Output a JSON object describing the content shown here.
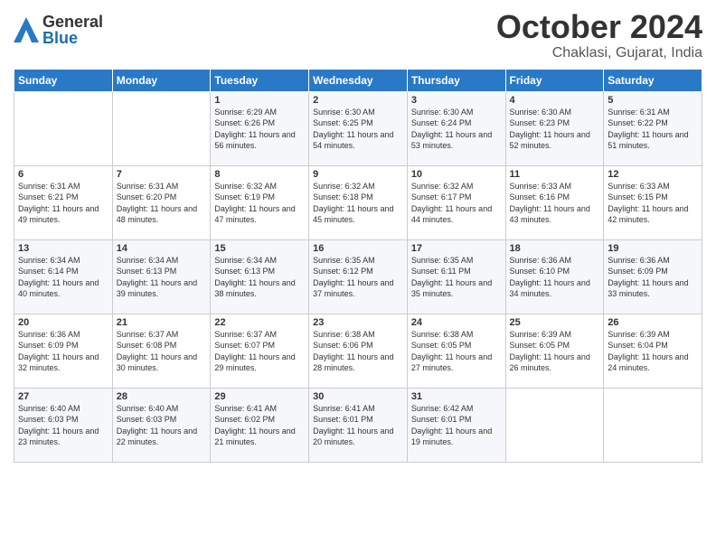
{
  "header": {
    "logo_general": "General",
    "logo_blue": "Blue",
    "month_title": "October 2024",
    "location": "Chaklasi, Gujarat, India"
  },
  "days_of_week": [
    "Sunday",
    "Monday",
    "Tuesday",
    "Wednesday",
    "Thursday",
    "Friday",
    "Saturday"
  ],
  "weeks": [
    [
      {
        "day": "",
        "sunrise": "",
        "sunset": "",
        "daylight": ""
      },
      {
        "day": "",
        "sunrise": "",
        "sunset": "",
        "daylight": ""
      },
      {
        "day": "1",
        "sunrise": "Sunrise: 6:29 AM",
        "sunset": "Sunset: 6:26 PM",
        "daylight": "Daylight: 11 hours and 56 minutes."
      },
      {
        "day": "2",
        "sunrise": "Sunrise: 6:30 AM",
        "sunset": "Sunset: 6:25 PM",
        "daylight": "Daylight: 11 hours and 54 minutes."
      },
      {
        "day": "3",
        "sunrise": "Sunrise: 6:30 AM",
        "sunset": "Sunset: 6:24 PM",
        "daylight": "Daylight: 11 hours and 53 minutes."
      },
      {
        "day": "4",
        "sunrise": "Sunrise: 6:30 AM",
        "sunset": "Sunset: 6:23 PM",
        "daylight": "Daylight: 11 hours and 52 minutes."
      },
      {
        "day": "5",
        "sunrise": "Sunrise: 6:31 AM",
        "sunset": "Sunset: 6:22 PM",
        "daylight": "Daylight: 11 hours and 51 minutes."
      }
    ],
    [
      {
        "day": "6",
        "sunrise": "Sunrise: 6:31 AM",
        "sunset": "Sunset: 6:21 PM",
        "daylight": "Daylight: 11 hours and 49 minutes."
      },
      {
        "day": "7",
        "sunrise": "Sunrise: 6:31 AM",
        "sunset": "Sunset: 6:20 PM",
        "daylight": "Daylight: 11 hours and 48 minutes."
      },
      {
        "day": "8",
        "sunrise": "Sunrise: 6:32 AM",
        "sunset": "Sunset: 6:19 PM",
        "daylight": "Daylight: 11 hours and 47 minutes."
      },
      {
        "day": "9",
        "sunrise": "Sunrise: 6:32 AM",
        "sunset": "Sunset: 6:18 PM",
        "daylight": "Daylight: 11 hours and 45 minutes."
      },
      {
        "day": "10",
        "sunrise": "Sunrise: 6:32 AM",
        "sunset": "Sunset: 6:17 PM",
        "daylight": "Daylight: 11 hours and 44 minutes."
      },
      {
        "day": "11",
        "sunrise": "Sunrise: 6:33 AM",
        "sunset": "Sunset: 6:16 PM",
        "daylight": "Daylight: 11 hours and 43 minutes."
      },
      {
        "day": "12",
        "sunrise": "Sunrise: 6:33 AM",
        "sunset": "Sunset: 6:15 PM",
        "daylight": "Daylight: 11 hours and 42 minutes."
      }
    ],
    [
      {
        "day": "13",
        "sunrise": "Sunrise: 6:34 AM",
        "sunset": "Sunset: 6:14 PM",
        "daylight": "Daylight: 11 hours and 40 minutes."
      },
      {
        "day": "14",
        "sunrise": "Sunrise: 6:34 AM",
        "sunset": "Sunset: 6:13 PM",
        "daylight": "Daylight: 11 hours and 39 minutes."
      },
      {
        "day": "15",
        "sunrise": "Sunrise: 6:34 AM",
        "sunset": "Sunset: 6:13 PM",
        "daylight": "Daylight: 11 hours and 38 minutes."
      },
      {
        "day": "16",
        "sunrise": "Sunrise: 6:35 AM",
        "sunset": "Sunset: 6:12 PM",
        "daylight": "Daylight: 11 hours and 37 minutes."
      },
      {
        "day": "17",
        "sunrise": "Sunrise: 6:35 AM",
        "sunset": "Sunset: 6:11 PM",
        "daylight": "Daylight: 11 hours and 35 minutes."
      },
      {
        "day": "18",
        "sunrise": "Sunrise: 6:36 AM",
        "sunset": "Sunset: 6:10 PM",
        "daylight": "Daylight: 11 hours and 34 minutes."
      },
      {
        "day": "19",
        "sunrise": "Sunrise: 6:36 AM",
        "sunset": "Sunset: 6:09 PM",
        "daylight": "Daylight: 11 hours and 33 minutes."
      }
    ],
    [
      {
        "day": "20",
        "sunrise": "Sunrise: 6:36 AM",
        "sunset": "Sunset: 6:09 PM",
        "daylight": "Daylight: 11 hours and 32 minutes."
      },
      {
        "day": "21",
        "sunrise": "Sunrise: 6:37 AM",
        "sunset": "Sunset: 6:08 PM",
        "daylight": "Daylight: 11 hours and 30 minutes."
      },
      {
        "day": "22",
        "sunrise": "Sunrise: 6:37 AM",
        "sunset": "Sunset: 6:07 PM",
        "daylight": "Daylight: 11 hours and 29 minutes."
      },
      {
        "day": "23",
        "sunrise": "Sunrise: 6:38 AM",
        "sunset": "Sunset: 6:06 PM",
        "daylight": "Daylight: 11 hours and 28 minutes."
      },
      {
        "day": "24",
        "sunrise": "Sunrise: 6:38 AM",
        "sunset": "Sunset: 6:05 PM",
        "daylight": "Daylight: 11 hours and 27 minutes."
      },
      {
        "day": "25",
        "sunrise": "Sunrise: 6:39 AM",
        "sunset": "Sunset: 6:05 PM",
        "daylight": "Daylight: 11 hours and 26 minutes."
      },
      {
        "day": "26",
        "sunrise": "Sunrise: 6:39 AM",
        "sunset": "Sunset: 6:04 PM",
        "daylight": "Daylight: 11 hours and 24 minutes."
      }
    ],
    [
      {
        "day": "27",
        "sunrise": "Sunrise: 6:40 AM",
        "sunset": "Sunset: 6:03 PM",
        "daylight": "Daylight: 11 hours and 23 minutes."
      },
      {
        "day": "28",
        "sunrise": "Sunrise: 6:40 AM",
        "sunset": "Sunset: 6:03 PM",
        "daylight": "Daylight: 11 hours and 22 minutes."
      },
      {
        "day": "29",
        "sunrise": "Sunrise: 6:41 AM",
        "sunset": "Sunset: 6:02 PM",
        "daylight": "Daylight: 11 hours and 21 minutes."
      },
      {
        "day": "30",
        "sunrise": "Sunrise: 6:41 AM",
        "sunset": "Sunset: 6:01 PM",
        "daylight": "Daylight: 11 hours and 20 minutes."
      },
      {
        "day": "31",
        "sunrise": "Sunrise: 6:42 AM",
        "sunset": "Sunset: 6:01 PM",
        "daylight": "Daylight: 11 hours and 19 minutes."
      },
      {
        "day": "",
        "sunrise": "",
        "sunset": "",
        "daylight": ""
      },
      {
        "day": "",
        "sunrise": "",
        "sunset": "",
        "daylight": ""
      }
    ]
  ]
}
